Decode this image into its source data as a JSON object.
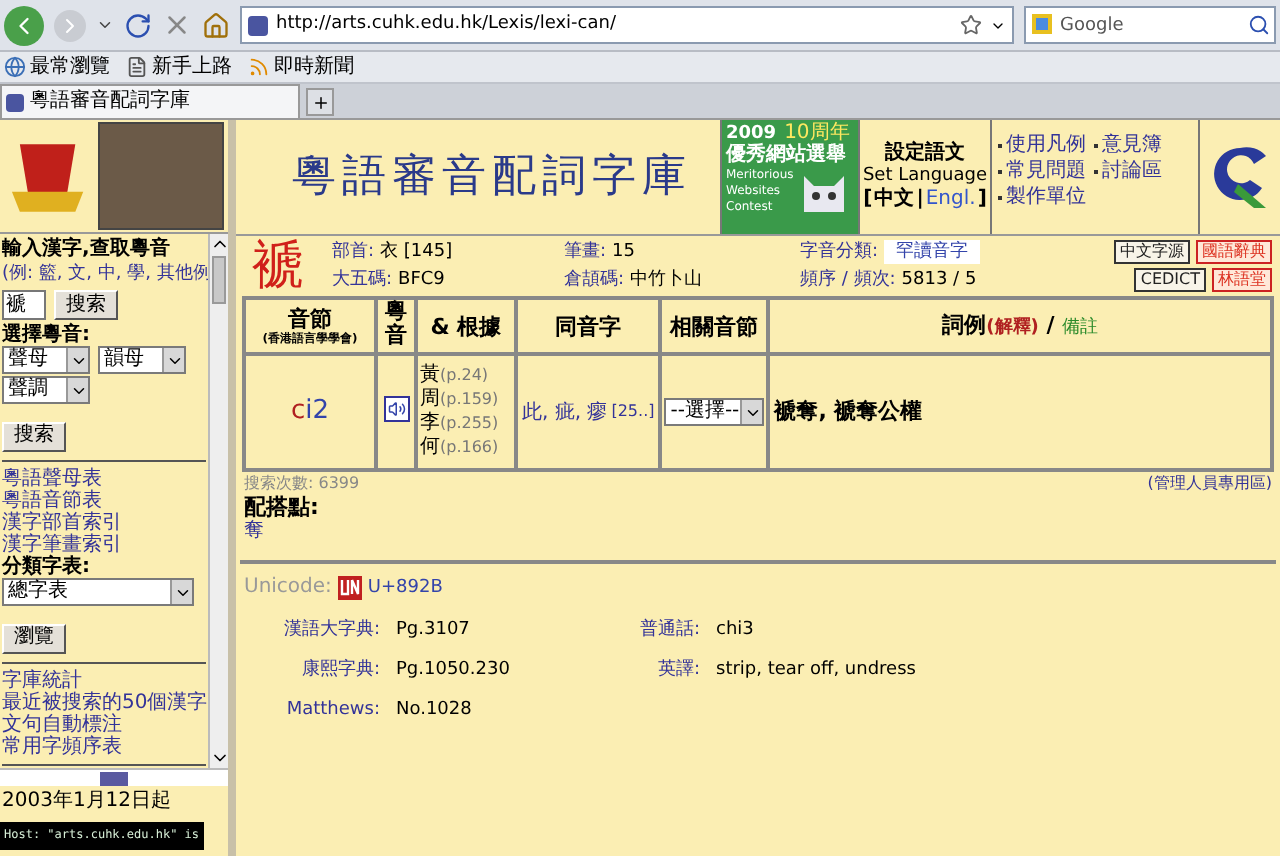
{
  "browser": {
    "url": "http://arts.cuhk.edu.hk/Lexis/lexi-can/",
    "search_placeholder": "Google",
    "bookmarks": [
      {
        "label": "最常瀏覽",
        "kind": "site"
      },
      {
        "label": "新手上路",
        "kind": "page"
      },
      {
        "label": "即時新聞",
        "kind": "feed"
      }
    ],
    "tabs": [
      {
        "label": "粵語審音配詞字庫",
        "selected": true
      }
    ]
  },
  "sidebar": {
    "search_title": "輸入漢字,查取粵音",
    "examples": "(例: 籃, 文, 中, 學, 其他例",
    "char_value": "褫",
    "search_button": "搜索",
    "sound_title": "選擇粵音:",
    "sound_selects": [
      "聲母",
      "韻母",
      "聲調"
    ],
    "sound_button": "搜索",
    "index_links": [
      "粵語聲母表",
      "粵語音節表",
      "漢字部首索引",
      "漢字筆畫索引"
    ],
    "category_label": "分類字表:",
    "category_value": "總字表",
    "browse_button": "瀏覽",
    "more_links": [
      "字庫統計",
      "最近被搜索的50個漢字",
      "文句自動標注",
      "常用字頻序表"
    ]
  },
  "footer": {
    "since": "2003年1月12日起",
    "status_tooltip": "Host: \"arts.cuhk.edu.hk\" is"
  },
  "header": {
    "title": "粵語審音配詞字庫",
    "award": {
      "year": "2009",
      "anniversary": "10周年",
      "name": "優秀網站選舉",
      "english": [
        "Meritorious",
        "Websites",
        "Contest"
      ]
    },
    "language": {
      "title": "設定語文",
      "subtitle": "Set Language",
      "open": "[",
      "separator": "|",
      "close": "]",
      "options": [
        {
          "label": "中文",
          "selected": true
        },
        {
          "label": "Engl.",
          "selected": false
        }
      ]
    },
    "links": [
      "使用凡例",
      "常見問題",
      "製作單位",
      "意見簿",
      "討論區"
    ]
  },
  "entry": {
    "character": "褫",
    "rows": [
      {
        "fields": [
          {
            "label": "部首:",
            "value": "衣 [145]",
            "kind": "plain"
          },
          {
            "label": "筆畫:",
            "value": "15",
            "kind": "plain"
          },
          {
            "label": "字音分類:",
            "value": "罕讀音字",
            "kind": "boxed"
          }
        ],
        "buttons": [
          {
            "label": "中文字源",
            "kind": "dark"
          },
          {
            "label": "國語辭典",
            "kind": "accent"
          }
        ]
      },
      {
        "fields": [
          {
            "label": "大五碼:",
            "value": "BFC9",
            "kind": "plain"
          },
          {
            "label": "倉頡碼:",
            "value": "中竹卜山",
            "kind": "plain"
          },
          {
            "label": "頻序 / 頻次:",
            "value": "5813 / 5",
            "kind": "plain"
          }
        ],
        "buttons": [
          {
            "label": "CEDICT",
            "kind": "dark"
          },
          {
            "label": "林語堂",
            "kind": "accent"
          }
        ]
      }
    ]
  },
  "table": {
    "columns": [
      {
        "label": "音節",
        "sub": "(香港語言學學會)",
        "kind": "plain"
      },
      {
        "label": "粵音",
        "kind": "vertical"
      },
      {
        "label": "& 根據",
        "kind": "plain"
      },
      {
        "label": "同音字",
        "kind": "plain"
      },
      {
        "label": "相關音節",
        "kind": "plain"
      },
      {
        "label": "詞例",
        "explain": "(解釋)",
        "separator": " / ",
        "note": "備註",
        "kind": "plain"
      }
    ],
    "rows": [
      {
        "initial": "c",
        "final": "i2",
        "sources": [
          {
            "name": "黃",
            "page": "(p.24)"
          },
          {
            "name": "周",
            "page": "(p.159)"
          },
          {
            "name": "李",
            "page": "(p.255)"
          },
          {
            "name": "何",
            "page": "(p.166)"
          }
        ],
        "homophones": "此, 疵, 瘳",
        "homophone_more": "[25..]",
        "related_select": "--選擇--",
        "examples": "褫奪, 褫奪公權"
      }
    ]
  },
  "stats": {
    "search_count": "搜索次數: 6399",
    "admin_link": "(管理人員專用區)",
    "collocation_label": "配搭點:",
    "collocation": "奪"
  },
  "unicode": {
    "label": "Unicode:",
    "code": "U+892B"
  },
  "details": [
    {
      "label": "漢語大字典:",
      "value": "Pg.3107"
    },
    {
      "label": "普通話:",
      "value": "chi3"
    },
    {
      "label": "康熙字典:",
      "value": "Pg.1050.230"
    },
    {
      "label": "英譯:",
      "value": "strip, tear off, undress"
    },
    {
      "label": "Matthews:",
      "value": "No.1028"
    }
  ]
}
